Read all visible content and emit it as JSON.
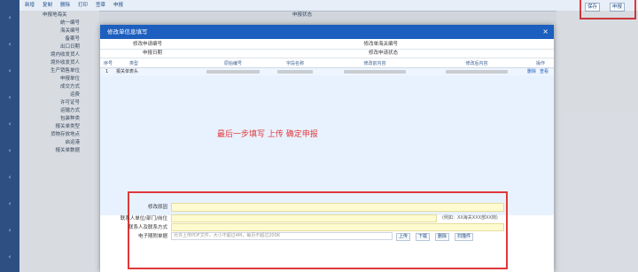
{
  "background": {
    "toolbar_buttons": [
      "新增",
      "复制",
      "删除",
      "打印",
      "签章",
      "申报"
    ],
    "top_field_label": "申报地海关",
    "top_mid_label": "申报状态",
    "left_field_labels": [
      "统一编号",
      "海关编号",
      "备案号",
      "出口日期",
      "境内收发货人",
      "境外收发货人",
      "生产销售单位",
      "申报单位",
      "成交方式",
      "运费",
      "许可证号",
      "运输方式",
      "包装种类",
      "报关单类型",
      "货物存放地点",
      "启运港",
      "报关单数据"
    ],
    "corner_buttons": [
      "保存",
      "申报"
    ]
  },
  "modal": {
    "title": "修改单信息填写",
    "close_icon": "×",
    "info": {
      "mod_no_label": "修改申请编号",
      "customs_no_label": "修改单海关编号",
      "declare_date_label": "申报日期",
      "status_label": "修改申请状态"
    },
    "table": {
      "headers": [
        "序号",
        "类型",
        "原始编号",
        "字段名称",
        "修改前内容",
        "修改后内容",
        "操作"
      ],
      "rows": [
        {
          "index": "1",
          "type": "报关单表头",
          "actions": [
            "删除",
            "查看"
          ]
        }
      ]
    },
    "annotation": "最后一步填写 上传 确定申报",
    "form": {
      "reason_label": "修改原因",
      "unit_label": "联系人单位/部门/岗位",
      "unit_hint": "(例如：XX海关XXX部XX岗)",
      "contact_label": "联系人及联系方式",
      "attachment_label": "电子随附单据",
      "attachment_placeholder": "允许上传PDF文件，大小不超过4M，每页不超过200K",
      "upload_buttons": [
        "上传",
        "下载",
        "删除",
        "扫描件"
      ]
    }
  }
}
